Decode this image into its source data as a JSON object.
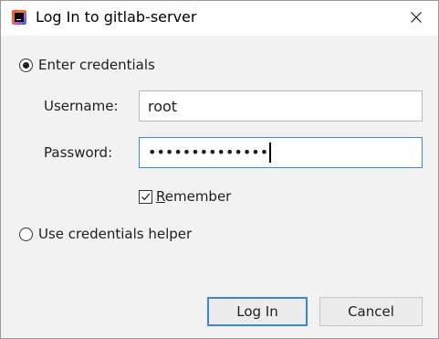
{
  "window": {
    "title": "Log In to gitlab-server",
    "app_icon": "intellij-idea-icon",
    "close_icon": "close-icon"
  },
  "auth_mode": {
    "credentials_label": "Enter credentials",
    "credentials_selected": true,
    "helper_label": "Use credentials helper",
    "helper_selected": false
  },
  "form": {
    "username_label": "Username:",
    "username_value": "root",
    "password_label": "Password:",
    "password_masked": "••••••••••••••",
    "remember_label": "Remember",
    "remember_checked": true
  },
  "buttons": {
    "login_label": "Log In",
    "cancel_label": "Cancel"
  },
  "colors": {
    "focus_accent": "#3b86d8",
    "background": "#f2f2f2"
  }
}
